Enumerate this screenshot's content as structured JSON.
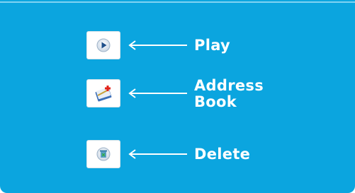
{
  "items": [
    {
      "label": "Play",
      "icon": "play-icon"
    },
    {
      "label": "Address\nBook",
      "icon": "address-book-icon"
    },
    {
      "label": "Delete",
      "icon": "delete-icon"
    }
  ],
  "colors": {
    "panel": "#0ba5df",
    "text": "#ffffff",
    "arrow": "#ffffff"
  }
}
